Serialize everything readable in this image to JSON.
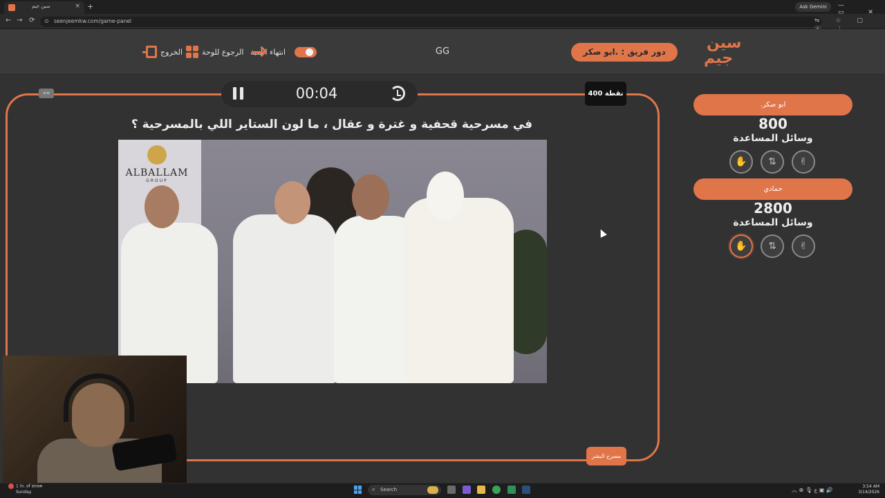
{
  "browser": {
    "tab_title": "سين جيم",
    "tab_close": "×",
    "new_tab": "+",
    "url": "seenjeemkw.com/game-panel",
    "ask_gemini": "Ask Gemini",
    "window_controls": "— ▭ ✕",
    "nav_icons": {
      "back": "←",
      "forward": "→",
      "reload": "⟳",
      "lock": "⊙"
    },
    "right_icons": "⇋ ☆ ▢ Ⓐ ⋮"
  },
  "header": {
    "logo_line1": "سين",
    "logo_line2": "جيم",
    "turn_label": "دور فريق : .ابو صكر",
    "room_name": "GG",
    "end_game_label": "انتهاء اللعبة",
    "back_to_board_label": "الرجوع للوحة",
    "exit_label": "الخروج"
  },
  "question_panel": {
    "timer": "00:04",
    "points": "400 نقطة",
    "small_chip": "≡≡",
    "question": "في مسرحية قحفية و غترة و عقال ، ما لون الستاير اللي بالمسرحية ؟",
    "category": "مسرح البشر",
    "image_logo_name": "ALBALLAM",
    "image_logo_sub": "GROUP"
  },
  "teams": [
    {
      "name": ".ابو صكر",
      "score": "800",
      "aids_label": "وسائل المساعدة",
      "aids": [
        {
          "icon": "hand-icon",
          "glyph": "✋",
          "active": false
        },
        {
          "icon": "two-arrows-icon",
          "glyph": "⇅",
          "active": false
        },
        {
          "icon": "peace-icon",
          "glyph": "✌",
          "active": false
        }
      ]
    },
    {
      "name": "حمادي",
      "score": "2800",
      "aids_label": "وسائل المساعدة",
      "aids": [
        {
          "icon": "hand-icon",
          "glyph": "✋",
          "active": true
        },
        {
          "icon": "two-arrows-icon",
          "glyph": "⇅",
          "active": false
        },
        {
          "icon": "peace-icon",
          "glyph": "✌",
          "active": false
        }
      ]
    }
  ],
  "taskbar": {
    "weather_line1": "1 in. of snow",
    "weather_line2": "Sunday",
    "search_placeholder": "Search",
    "search_icon": "⌕",
    "time": "3:54 AM",
    "date": "3/14/2026",
    "tray": "︿ ⊕ 🎙 ع ▣ 🔊"
  },
  "colors": {
    "accent": "#e0754a",
    "background": "#323232",
    "header": "#3a3a3a"
  }
}
